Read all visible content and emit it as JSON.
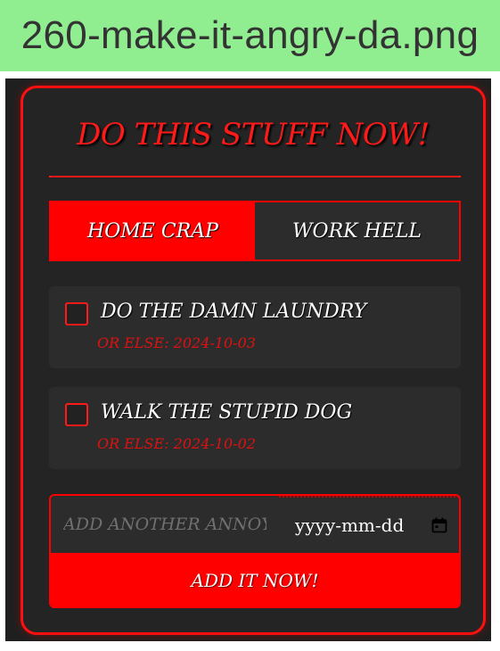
{
  "screenshot": {
    "filename": "260-make-it-angry-da.png"
  },
  "header": {
    "title": "DO THIS STUFF NOW!"
  },
  "tabs": [
    {
      "label": "HOME CRAP",
      "active": true
    },
    {
      "label": "WORK HELL",
      "active": false
    }
  ],
  "tasks": [
    {
      "text": "DO THE DAMN LAUNDRY",
      "due": "OR ELSE: 2024-10-03",
      "checked": false
    },
    {
      "text": "WALK THE STUPID DOG",
      "due": "OR ELSE: 2024-10-02",
      "checked": false
    }
  ],
  "add_form": {
    "task_placeholder": "ADD ANOTHER ANNOYING TASK",
    "date_placeholder": "yyyy-mm-dd",
    "button_label": "ADD IT NOW!"
  },
  "icons": {
    "calendar": "calendar-icon"
  },
  "colors": {
    "accent": "#ff0000",
    "background": "#242424",
    "panel": "#2c2c2c",
    "filename_bar": "#90ee90"
  }
}
